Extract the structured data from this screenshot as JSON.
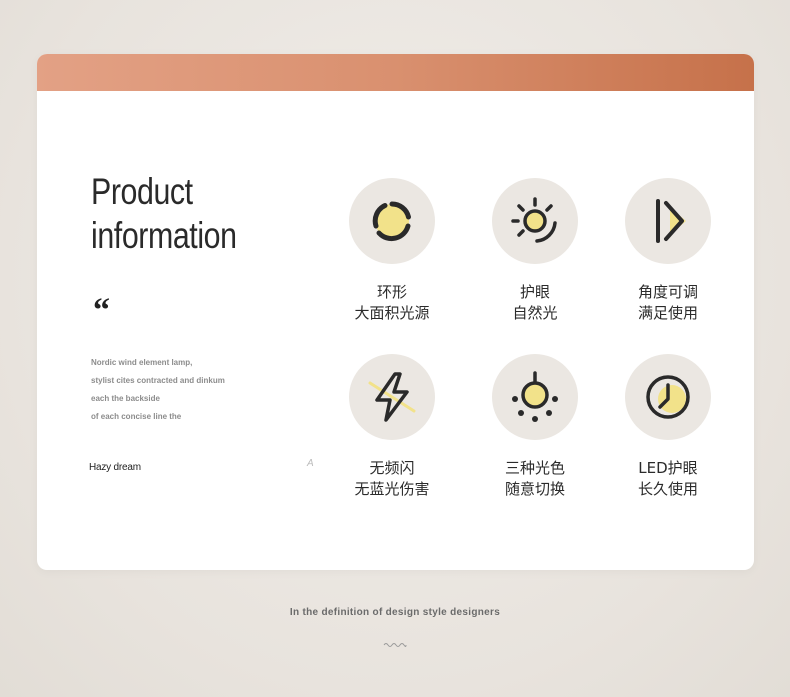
{
  "title": {
    "line1": "Product",
    "line2": "information"
  },
  "quote_mark": "“",
  "description": [
    "Nordic wind element lamp,",
    "stylist cites contracted and dinkum",
    "each the backside",
    "of each concise line the"
  ],
  "signature": "Hazy dream",
  "mark": "A",
  "features": [
    {
      "icon": "ring-light-icon",
      "line1": "环形",
      "line2": "大面积光源"
    },
    {
      "icon": "sun-eye-care-icon",
      "line1": "护眼",
      "line2": "自然光"
    },
    {
      "icon": "adjustable-angle-icon",
      "line1": "角度可调",
      "line2": "满足使用"
    },
    {
      "icon": "no-flicker-bolt-icon",
      "line1": "无频闪",
      "line2": "无蓝光伤害"
    },
    {
      "icon": "bulb-color-icon",
      "line1": "三种光色",
      "line2": "随意切换"
    },
    {
      "icon": "clock-longlife-icon",
      "line1": "LED护眼",
      "line2": "长久使用"
    }
  ],
  "footer": "In the definition of design style designers",
  "colors": {
    "accent_start": "#e3a185",
    "accent_end": "#c6714a",
    "icon_yellow": "#f2e28a",
    "icon_stroke": "#2a2a2a",
    "icon_bg": "#ebe7e2"
  }
}
